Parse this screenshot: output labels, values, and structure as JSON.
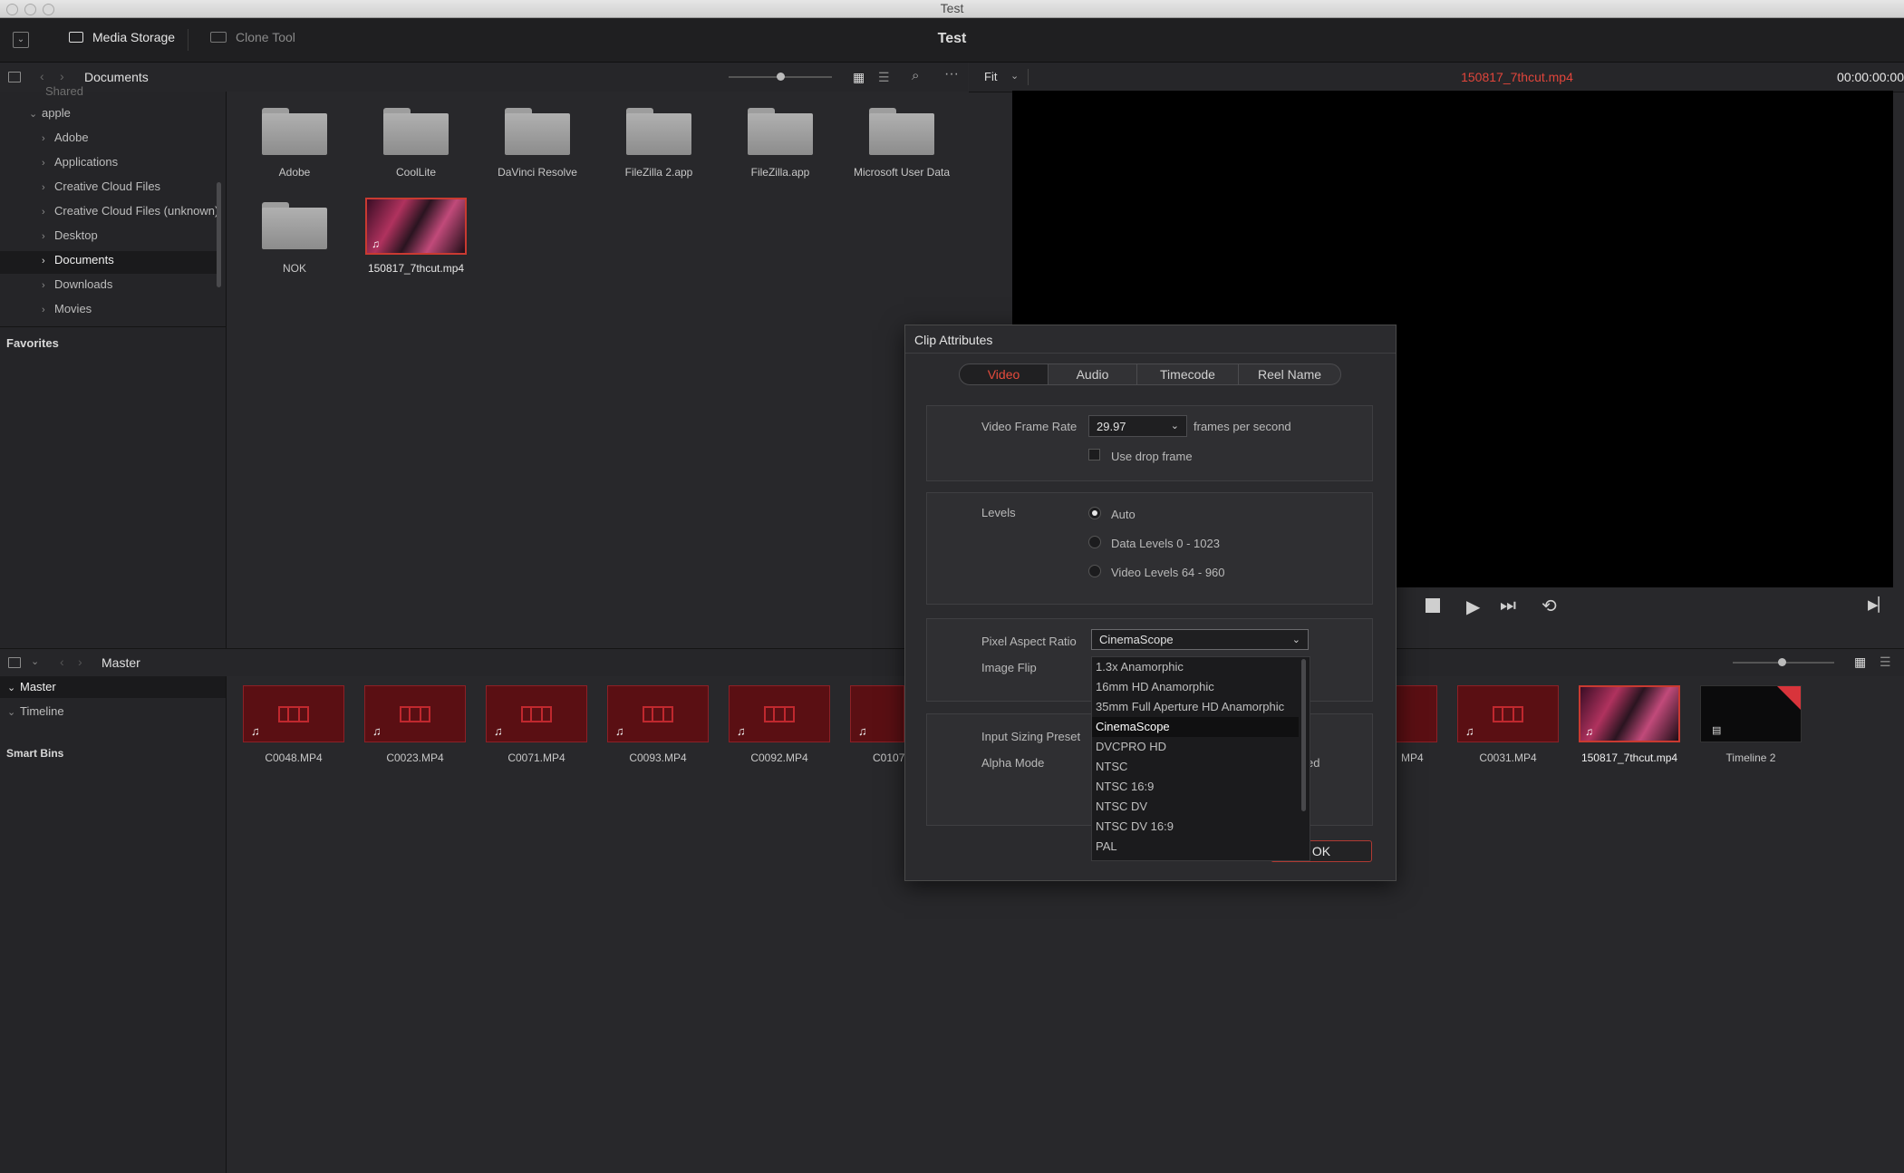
{
  "window": {
    "title": "Test"
  },
  "toolbar": {
    "media_storage": "Media Storage",
    "clone_tool": "Clone Tool",
    "project_title": "Test"
  },
  "storage_path": {
    "current": "Documents"
  },
  "viewer": {
    "zoom": "Fit",
    "clip_name": "150817_7thcut.mp4",
    "timecode": "00:00:00:00"
  },
  "tree": {
    "partial_top": "Shared",
    "root": "apple",
    "items": [
      "Adobe",
      "Applications",
      "Creative Cloud Files",
      "Creative Cloud Files (unknown)",
      "Desktop",
      "Documents",
      "Downloads",
      "Movies"
    ],
    "favorites": "Favorites"
  },
  "files": {
    "folders": [
      "Adobe",
      "CoolLite",
      "DaVinci Resolve",
      "FileZilla 2.app",
      "FileZilla.app",
      "Microsoft User Data",
      "NOK"
    ],
    "video": "150817_7thcut.mp4"
  },
  "pool": {
    "path": "Master",
    "bins": {
      "master": "Master",
      "timeline": "Timeline",
      "smart_bins": "Smart Bins"
    },
    "clips": [
      "C0048.MP4",
      "C0023.MP4",
      "C0071.MP4",
      "C0093.MP4",
      "C0092.MP4",
      "C0107.",
      "MP4",
      "C0031.MP4",
      "150817_7thcut.mp4",
      "Timeline 2"
    ]
  },
  "dialog": {
    "title": "Clip Attributes",
    "tabs": [
      "Video",
      "Audio",
      "Timecode",
      "Reel Name"
    ],
    "active_tab": "Video",
    "frame_rate_label": "Video Frame Rate",
    "frame_rate_value": "29.97",
    "frame_rate_unit": "frames per second",
    "drop_frame": "Use drop frame",
    "levels_label": "Levels",
    "levels": [
      "Auto",
      "Data Levels 0 - 1023",
      "Video Levels 64 - 960"
    ],
    "pixel_aspect_label": "Pixel Aspect Ratio",
    "pixel_aspect_value": "CinemaScope",
    "image_flip_label": "Image Flip",
    "input_sizing_label": "Input Sizing Preset",
    "alpha_mode_label": "Alpha Mode",
    "alpha_partial": "ed",
    "ok": "OK",
    "dropdown_options": [
      "1.3x Anamorphic",
      "16mm HD Anamorphic",
      "35mm Full Aperture HD Anamorphic",
      "CinemaScope",
      "DVCPRO HD",
      "NTSC",
      "NTSC 16:9",
      "NTSC DV",
      "NTSC DV 16:9",
      "PAL"
    ]
  }
}
